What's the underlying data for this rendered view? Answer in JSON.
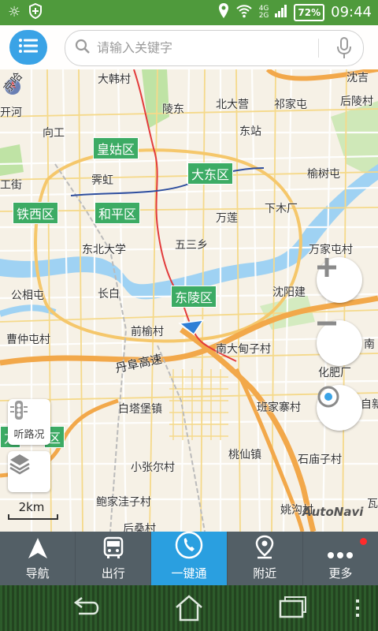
{
  "status_bar": {
    "network_top": "4G",
    "network_bottom": "2G",
    "battery": "72%",
    "time": "09:44"
  },
  "search": {
    "placeholder": "请输入关键字"
  },
  "map": {
    "districts": [
      "皇姑区",
      "大东区",
      "铁西区",
      "和平区",
      "东陵区",
      "方",
      "区"
    ],
    "places": [
      "大韩村",
      "陵东",
      "北大营",
      "祁家屯",
      "后陵村",
      "开河",
      "向工",
      "东站",
      "榆树屯",
      "霁虹",
      "工街",
      "下木厂",
      "万莲",
      "东北大学",
      "五三乡",
      "万家屯村",
      "公相屯",
      "长白",
      "沈阳建",
      "前榆村",
      "曹仲屯村",
      "南大甸子村",
      "南",
      "化肥厂",
      "白塔堡镇",
      "班家寨村",
      "自新",
      "桃仙镇",
      "石庙子村",
      "小张尔村",
      "鲍家洼子村",
      "姚沟村",
      "后桑村",
      "沈吉",
      "京哈",
      "瓦"
    ],
    "road_label": "丹阜高速",
    "traffic_label": "听路况",
    "scale": "2km",
    "brand": "AutoNavi"
  },
  "nav": {
    "items": [
      {
        "label": "导航",
        "icon": "navigate-arrow-icon"
      },
      {
        "label": "出行",
        "icon": "bus-icon"
      },
      {
        "label": "一键通",
        "icon": "phone-icon"
      },
      {
        "label": "附近",
        "icon": "location-pin-icon"
      },
      {
        "label": "更多",
        "icon": "more-dots-icon"
      }
    ]
  },
  "colors": {
    "status_bar": "#4f9a3c",
    "accent": "#2a9fe0",
    "nav_bg": "#535f66",
    "district_label": "#3cab64",
    "highway": "#f2a84a",
    "river": "#9fd2f3",
    "park": "#bfe3a5"
  }
}
